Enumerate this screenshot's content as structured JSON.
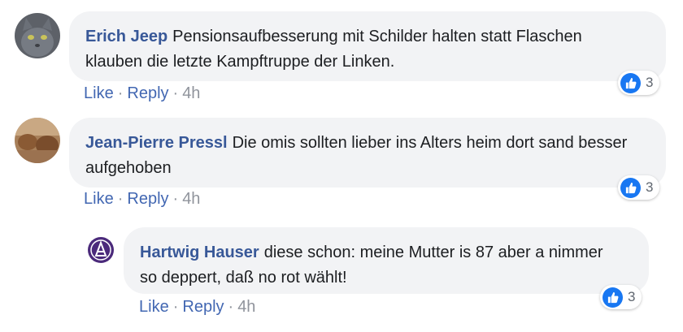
{
  "comments": [
    {
      "author": "Erich Jeep",
      "text": "Pensionsaufbesserung mit Schilder halten statt Flaschen klauben die letzte Kampftruppe der Linken.",
      "like_label": "Like",
      "reply_label": "Reply",
      "time": "4h",
      "reaction_count": "3",
      "reaction_icon": "thumbs-up-icon"
    },
    {
      "author": "Jean-Pierre Pressl",
      "text": "Die omis sollten lieber ins Alters heim dort sand besser aufgehoben",
      "like_label": "Like",
      "reply_label": "Reply",
      "time": "4h",
      "reaction_count": "3",
      "reaction_icon": "thumbs-up-icon"
    }
  ],
  "reply": {
    "author": "Hartwig Hauser",
    "text": "diese schon: meine Mutter is 87 aber a nimmer so deppert, daß no rot wählt!",
    "like_label": "Like",
    "reply_label": "Reply",
    "time": "4h",
    "reaction_count": "3",
    "reaction_icon": "thumbs-up-icon"
  },
  "colors": {
    "author_link": "#385898",
    "action_link": "#4267b2",
    "bubble_bg": "#f2f3f5",
    "like_blue": "#1877f2",
    "muted": "#90949c"
  }
}
